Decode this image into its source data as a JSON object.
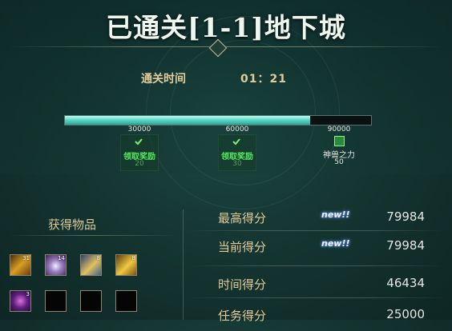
{
  "header": {
    "title": "已通关[1-1]地下城"
  },
  "clear_time": {
    "label": "通关时间",
    "value": "01：21"
  },
  "progress": {
    "fraction": 0.8,
    "milestones": [
      {
        "score": "30000",
        "reward": "领取奖励",
        "amount": "20",
        "claimed": true
      },
      {
        "score": "60000",
        "reward": "领取奖励",
        "amount": "30",
        "claimed": true
      },
      {
        "score": "90000",
        "reward": "神兽之力",
        "amount": "50",
        "claimed": false
      }
    ]
  },
  "items": {
    "heading": "获得物品",
    "slots": [
      {
        "icon": "gold-ore-icon",
        "count": "31"
      },
      {
        "icon": "purple-crystal-icon",
        "count": "14"
      },
      {
        "icon": "blue-gold-ticket-icon",
        "count": "8"
      },
      {
        "icon": "gold-scroll-icon",
        "count": "8"
      },
      {
        "icon": "purple-orb-icon",
        "count": "3"
      },
      {
        "icon": "empty-slot",
        "count": ""
      },
      {
        "icon": "empty-slot",
        "count": ""
      },
      {
        "icon": "empty-slot",
        "count": ""
      }
    ]
  },
  "scores": [
    {
      "label": "最高得分",
      "badge": "new!!",
      "value": "79984"
    },
    {
      "label": "当前得分",
      "badge": "new!!",
      "value": "79984"
    },
    {
      "label": "时间得分",
      "badge": "",
      "value": "46434"
    },
    {
      "label": "任务得分",
      "badge": "",
      "value": "25000"
    }
  ],
  "colors": {
    "accent_gold": "#e2cc9a",
    "progress_fill": "#5fd7c7",
    "reward_green": "#56e860",
    "background": "#153632"
  }
}
